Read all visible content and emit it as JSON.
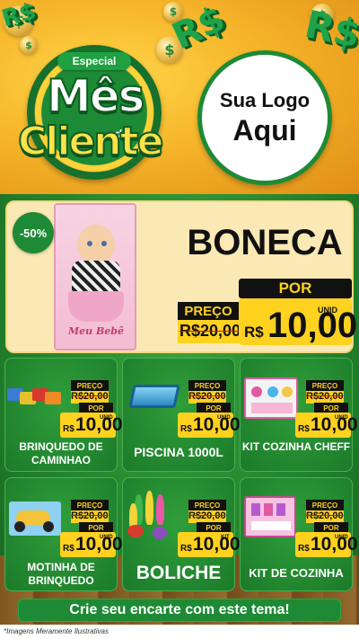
{
  "header": {
    "badge": {
      "ribbon": "Especial",
      "word1": "Mês",
      "word2": "do",
      "word3": "Cliente"
    },
    "logo": {
      "line1": "Sua Logo",
      "line2": "Aqui"
    },
    "coin_symbol": "$",
    "money_symbol": "R$"
  },
  "featured": {
    "discount": "-50%",
    "name": "BONECA",
    "box_label": "Meu Bebê",
    "por_label": "POR",
    "preco_label": "PREÇO",
    "old_price": "R$20,00",
    "currency": "R$",
    "new_price": "10,00",
    "unit": "UNID"
  },
  "products": [
    {
      "name": "BRINQUEDO DE CAMINHAO",
      "preco_label": "PREÇO",
      "old_price": "R$20,00",
      "por_label": "POR",
      "currency": "R$",
      "new_price": "10,00",
      "unit": "UNID"
    },
    {
      "name": "PISCINA 1000L",
      "preco_label": "PREÇO",
      "old_price": "R$20,00",
      "por_label": "POR",
      "currency": "R$",
      "new_price": "10,00",
      "unit": "UNID"
    },
    {
      "name": "KIT COZINHA CHEFF",
      "preco_label": "PREÇO",
      "old_price": "R$20,00",
      "por_label": "POR",
      "currency": "R$",
      "new_price": "10,00",
      "unit": "UNID"
    },
    {
      "name": "MOTINHA DE BRINQUEDO",
      "preco_label": "PREÇO",
      "old_price": "R$20,00",
      "por_label": "POR",
      "currency": "R$",
      "new_price": "10,00",
      "unit": "UNID"
    },
    {
      "name": "BOLICHE",
      "preco_label": "PREÇO",
      "old_price": "R$20,00",
      "por_label": "POR",
      "currency": "R$",
      "new_price": "10,00",
      "unit": "KIT"
    },
    {
      "name": "KIT DE COZINHA",
      "preco_label": "PREÇO",
      "old_price": "R$20,00",
      "por_label": "POR",
      "currency": "R$",
      "new_price": "10,00",
      "unit": "UNID"
    }
  ],
  "cta": "Crie seu encarte com este tema!",
  "footnote": "*Imagens Meramente Ilustrativas",
  "colors": {
    "green": "#1e8a35",
    "yellow": "#ffd21f",
    "cream": "#fbe9b5",
    "gold": "#f6b52a"
  }
}
